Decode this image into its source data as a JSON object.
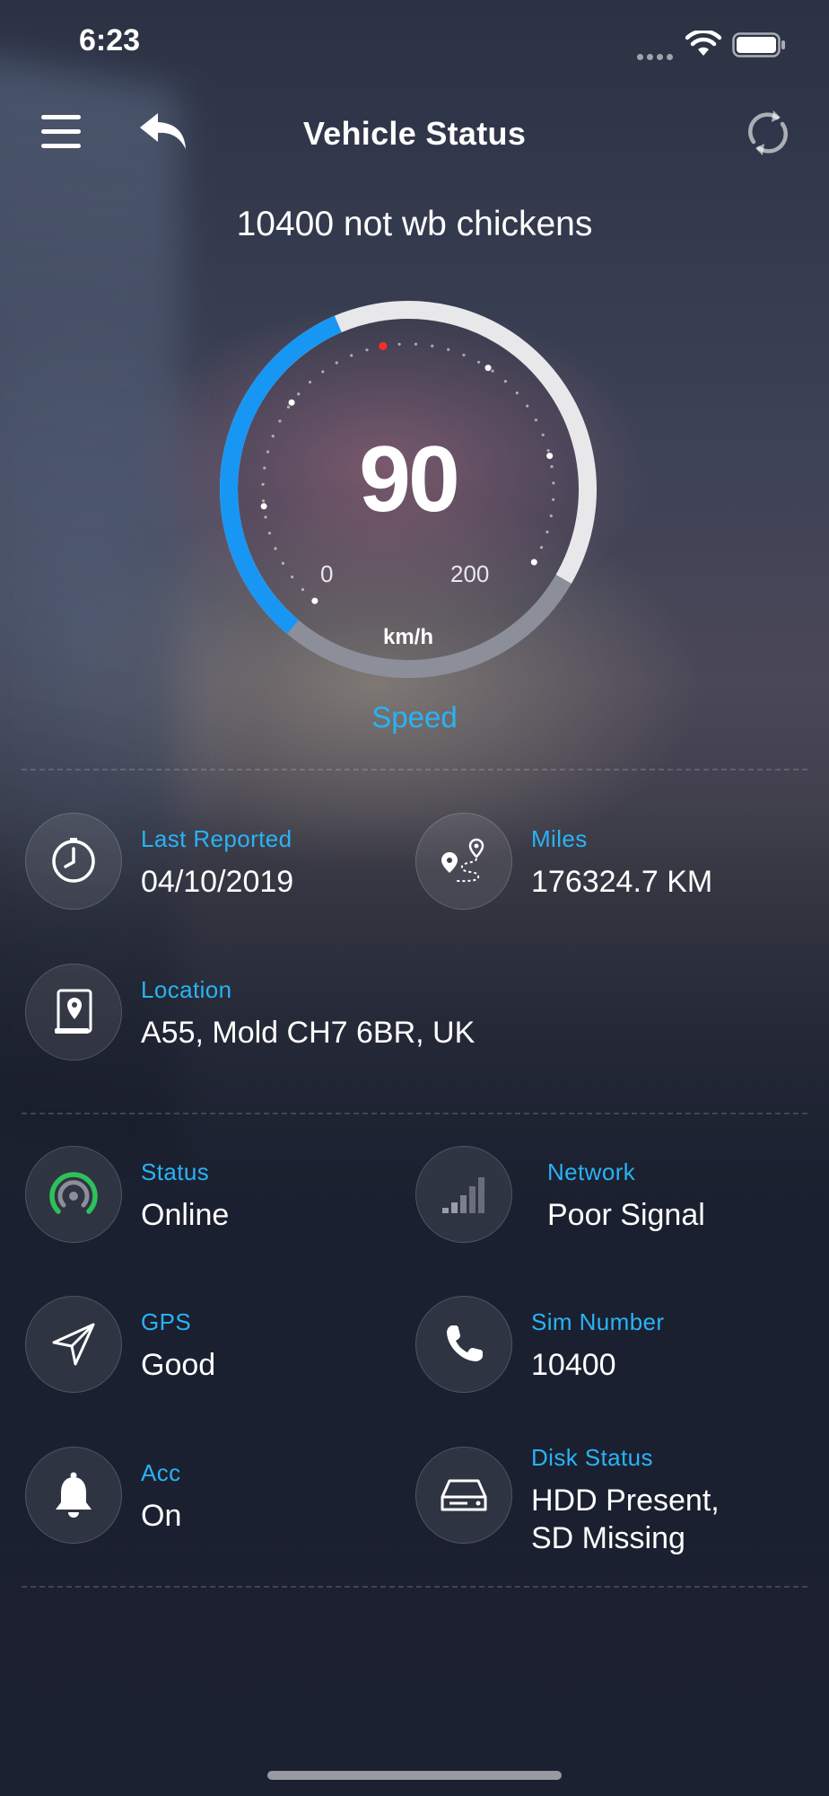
{
  "status_bar": {
    "time": "6:23"
  },
  "header": {
    "title": "Vehicle Status"
  },
  "vehicle": {
    "name": "10400 not wb chickens"
  },
  "speedometer": {
    "value": "90",
    "min_label": "0",
    "max_label": "200",
    "unit": "km/h",
    "label": "Speed",
    "value_fraction": 0.45
  },
  "details": {
    "last_reported": {
      "label": "Last Reported",
      "value": "04/10/2019",
      "icon": "clock-icon"
    },
    "miles": {
      "label": "Miles",
      "value": "176324.7 KM",
      "icon": "route-icon"
    },
    "location": {
      "label": "Location",
      "value": "A55, Mold CH7 6BR, UK",
      "icon": "address-book-icon"
    }
  },
  "status_items": {
    "status": {
      "label": "Status",
      "value": "Online",
      "icon": "signal-broadcast-icon"
    },
    "network": {
      "label": "Network",
      "value": "Poor Signal",
      "icon": "signal-bars-icon"
    },
    "gps": {
      "label": "GPS",
      "value": "Good",
      "icon": "navigation-arrow-icon"
    },
    "sim": {
      "label": "Sim Number",
      "value": "10400",
      "icon": "phone-icon"
    },
    "acc": {
      "label": "Acc",
      "value": "On",
      "icon": "bell-icon"
    },
    "disk": {
      "label": "Disk Status",
      "value_line1": "HDD Present,",
      "value_line2": "SD Missing",
      "icon": "hard-drive-icon"
    }
  },
  "colors": {
    "accent_blue": "#29b3f5",
    "gauge_active": "#1896f3",
    "online_green": "#2ec15a",
    "gauge_red_dot": "#ff2a2a"
  }
}
